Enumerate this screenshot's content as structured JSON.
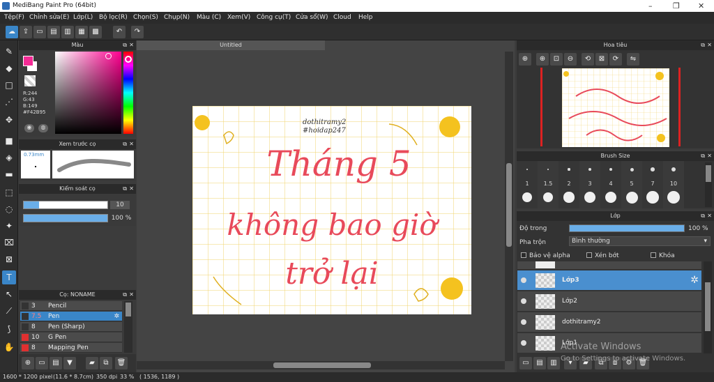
{
  "window": {
    "title": "MediBang Paint Pro (64bit)",
    "minimize": "–",
    "maximize": "❐",
    "close": "✕"
  },
  "menu": [
    "Tệp(F)",
    "Chỉnh sửa(E)",
    "Lớp(L)",
    "Bộ lọc(R)",
    "Chọn(S)",
    "Chụp(N)",
    "Màu (C)",
    "Xem(V)",
    "Công cụ(T)",
    "Cửa sổ(W)",
    "Cloud",
    "Help"
  ],
  "document": {
    "tab": "Untitled"
  },
  "color_panel": {
    "title": "Màu",
    "r": "R:244",
    "g": "G:43",
    "b": "B:149",
    "hex": "#F42B95",
    "fg": "#F42B95",
    "bg": "#ffffff"
  },
  "preview_panel": {
    "title": "Xem trước cọ",
    "size": "0.73mm"
  },
  "brush_control": {
    "title": "Kiểm soát cọ",
    "size": "10",
    "opacity": "100 %",
    "opacity_value": 100
  },
  "brush_panel": {
    "title": "Cọ: NONAME",
    "items": [
      {
        "size": "3",
        "name": "Pencil",
        "color": "#333333"
      },
      {
        "size": "7.5",
        "name": "Pen",
        "color": "#333333",
        "selected": true
      },
      {
        "size": "8",
        "name": "Pen (Sharp)",
        "color": "#333333"
      },
      {
        "size": "10",
        "name": "G Pen",
        "color": "#e03030"
      },
      {
        "size": "8",
        "name": "Mapping Pen",
        "color": "#e03030"
      }
    ]
  },
  "navigator": {
    "title": "Hoa tiêu"
  },
  "brush_size": {
    "title": "Brush Size",
    "sizes": [
      "1",
      "1.5",
      "2",
      "3",
      "4",
      "5",
      "7",
      "10"
    ]
  },
  "layer_panel": {
    "title": "Lớp",
    "opacity_label": "Độ trong",
    "opacity": "100 %",
    "opacity_value": 100,
    "blend_label": "Pha trộn",
    "blend": "Bình thường",
    "protect_alpha": "Bảo vệ alpha",
    "clipping": "Xén bớt",
    "lock": "Khóa",
    "layers": [
      {
        "name": "Lớp3",
        "selected": true
      },
      {
        "name": "Lớp2"
      },
      {
        "name": "dothitramy2"
      },
      {
        "name": "Lớp1"
      }
    ]
  },
  "artwork": {
    "line1": "Tháng 5",
    "line2": "không bao giờ",
    "line3": "trở lại",
    "tag1": "dothitramy2",
    "tag2": "#hoidap247"
  },
  "watermark": {
    "line1": "Activate Windows",
    "line2": "Go to Settings to activate Windows."
  },
  "status": {
    "size": "1600 * 1200 pixel",
    "cm": "(11.6 * 8.7cm)",
    "dpi": "350 dpi",
    "zoom": "33 %",
    "coords": "( 1536, 1189 )"
  }
}
